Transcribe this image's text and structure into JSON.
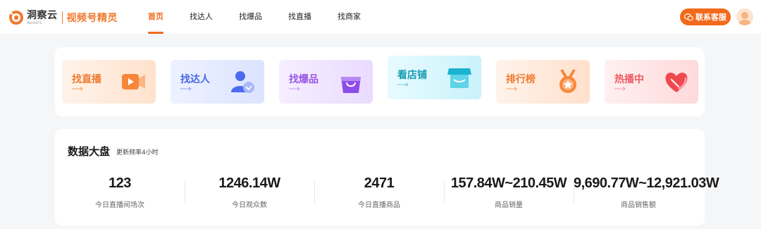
{
  "header": {
    "logo_text": "洞察云",
    "logo_sub": "INSIGHTS",
    "product_name": "视频号精灵",
    "nav": [
      {
        "label": "首页",
        "active": true
      },
      {
        "label": "找达人",
        "active": false
      },
      {
        "label": "找爆品",
        "active": false
      },
      {
        "label": "找直播",
        "active": false
      },
      {
        "label": "找商家",
        "active": false
      }
    ],
    "contact_label": "联系客服",
    "accent_color": "#f26a1b"
  },
  "categories": [
    {
      "label": "找直播",
      "icon": "video-play-icon",
      "text_color": "#f07a2f"
    },
    {
      "label": "找达人",
      "icon": "user-icon",
      "text_color": "#4a66e8"
    },
    {
      "label": "找爆品",
      "icon": "shopping-bag-icon",
      "text_color": "#9a58e6"
    },
    {
      "label": "看店铺",
      "icon": "shop-icon",
      "text_color": "#159bb3"
    },
    {
      "label": "排行榜",
      "icon": "medal-icon",
      "text_color": "#f07a2f"
    },
    {
      "label": "热播中",
      "icon": "heart-icon",
      "text_color": "#ef5b62"
    }
  ],
  "dashboard": {
    "title": "数据大盘",
    "subtitle": "更新频率4小时",
    "stats": [
      {
        "value": "123",
        "label": "今日直播间场次"
      },
      {
        "value": "1246.14W",
        "label": "今日观众数"
      },
      {
        "value": "2471",
        "label": "今日直播商品"
      },
      {
        "value": "157.84W~210.45W",
        "label": "商品销量"
      },
      {
        "value": "9,690.77W~12,921.03W",
        "label": "商品销售额"
      }
    ]
  }
}
